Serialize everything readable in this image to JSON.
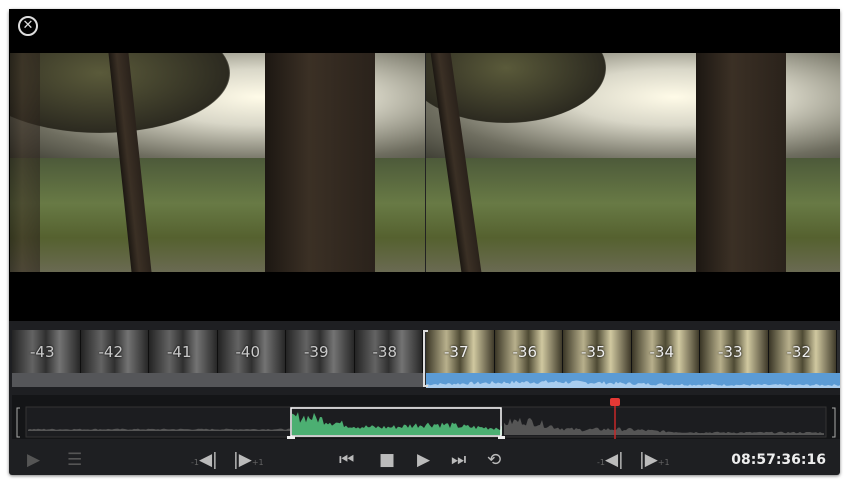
{
  "viewer": {
    "close_icon": "close-circle-icon"
  },
  "filmstrip": {
    "left_labels": [
      "-43",
      "-42",
      "-41",
      "-40",
      "-39",
      "-38"
    ],
    "right_labels": [
      "-37",
      "-36",
      "-35",
      "-34",
      "-33",
      "-32"
    ]
  },
  "transport": {
    "jog_back_label": "-1",
    "jog_fwd_label": "+1",
    "jog_back2_label": "-1",
    "jog_fwd2_label": "+1",
    "timecode": "08:57:36:16"
  },
  "colors": {
    "selection": "#4caf72",
    "playhead": "#e53935",
    "audio": "#5b9bd5"
  }
}
